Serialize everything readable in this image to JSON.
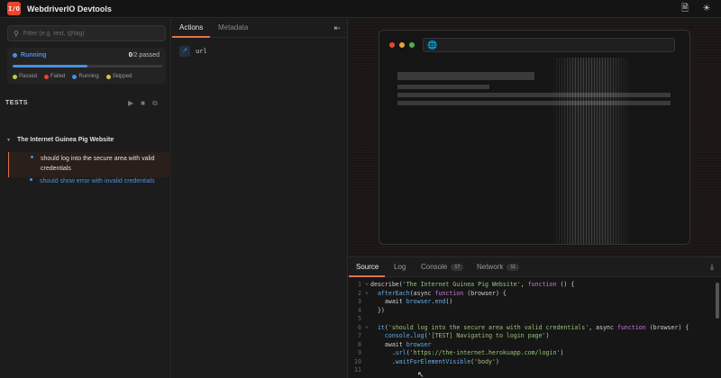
{
  "header": {
    "logo_text": "I/O",
    "title": "WebdriverIO Devtools"
  },
  "sidebar": {
    "filter_placeholder": "Filter (e.g. text, @tag)",
    "status": {
      "label": "Running",
      "count_done": "0",
      "count_total": "/2 passed",
      "progress": 0.5
    },
    "legend": [
      {
        "label": "Passed",
        "color": "#b5d33c"
      },
      {
        "label": "Failed",
        "color": "#e8462a"
      },
      {
        "label": "Running",
        "color": "#4a90e2"
      },
      {
        "label": "Skipped",
        "color": "#d8c14a"
      }
    ],
    "tests_label": "TESTS",
    "suite_title": "The Internet Guinea Pig Website",
    "tests": [
      {
        "title": "should log into the secure area with valid credentials",
        "state": "active"
      },
      {
        "title": "should show error with invalid credentials",
        "state": "pending"
      }
    ]
  },
  "actions_panel": {
    "tabs": [
      "Actions",
      "Metadata"
    ],
    "items": [
      {
        "icon": "arrow-up-right-icon",
        "label": "url"
      }
    ]
  },
  "source_panel": {
    "tabs": [
      {
        "label": "Source",
        "badge": ""
      },
      {
        "label": "Log",
        "badge": ""
      },
      {
        "label": "Console",
        "badge": "17"
      },
      {
        "label": "Network",
        "badge": "11"
      }
    ],
    "code": [
      {
        "n": "1",
        "fold": true,
        "html": "<span class='pl'>describe(</span><span class='str'>'The Internet Guinea Pig Website'</span><span class='pl'>, </span><span class='kw'>function</span><span class='pl'> () {</span>"
      },
      {
        "n": "2",
        "fold": true,
        "html": "<span class='pl'>  </span><span class='fn'>afterEach</span><span class='pl'>(async </span><span class='kw'>function</span><span class='pl'> (browser) {</span>"
      },
      {
        "n": "3",
        "fold": false,
        "html": "<span class='pl'>    await </span><span class='fn'>browser</span><span class='pl'>.</span><span class='fn'>end</span><span class='pl'>()</span>"
      },
      {
        "n": "4",
        "fold": false,
        "html": "<span class='pl'>  })</span>"
      },
      {
        "n": "5",
        "fold": false,
        "html": ""
      },
      {
        "n": "6",
        "fold": true,
        "html": "<span class='pl'>  </span><span class='fn'>it</span><span class='pl'>(</span><span class='str'>'should log into the secure area with valid credentials'</span><span class='pl'>, async </span><span class='kw'>function</span><span class='pl'> (browser) {</span>"
      },
      {
        "n": "7",
        "fold": false,
        "html": "<span class='pl'>    </span><span class='fn'>console</span><span class='pl'>.</span><span class='fn'>log</span><span class='pl'>(</span><span class='str'>'[TEST] Navigating to login page'</span><span class='pl'>)</span>"
      },
      {
        "n": "8",
        "fold": false,
        "html": "<span class='pl'>    await </span><span class='fn'>browser</span>"
      },
      {
        "n": "9",
        "fold": false,
        "html": "<span class='pl'>      .</span><span class='fn'>url</span><span class='pl'>(</span><span class='str'>'https://the-internet.herokuapp.com/login'</span><span class='pl'>)</span>"
      },
      {
        "n": "10",
        "fold": false,
        "html": "<span class='pl'>      .</span><span class='fn'>waitForElementVisible</span><span class='pl'>(</span><span class='str'>'body'</span><span class='pl'>)</span>"
      },
      {
        "n": "11",
        "fold": false,
        "html": ""
      }
    ]
  },
  "colors": {
    "accent": "#e0724a",
    "blue": "#4a90e2"
  }
}
